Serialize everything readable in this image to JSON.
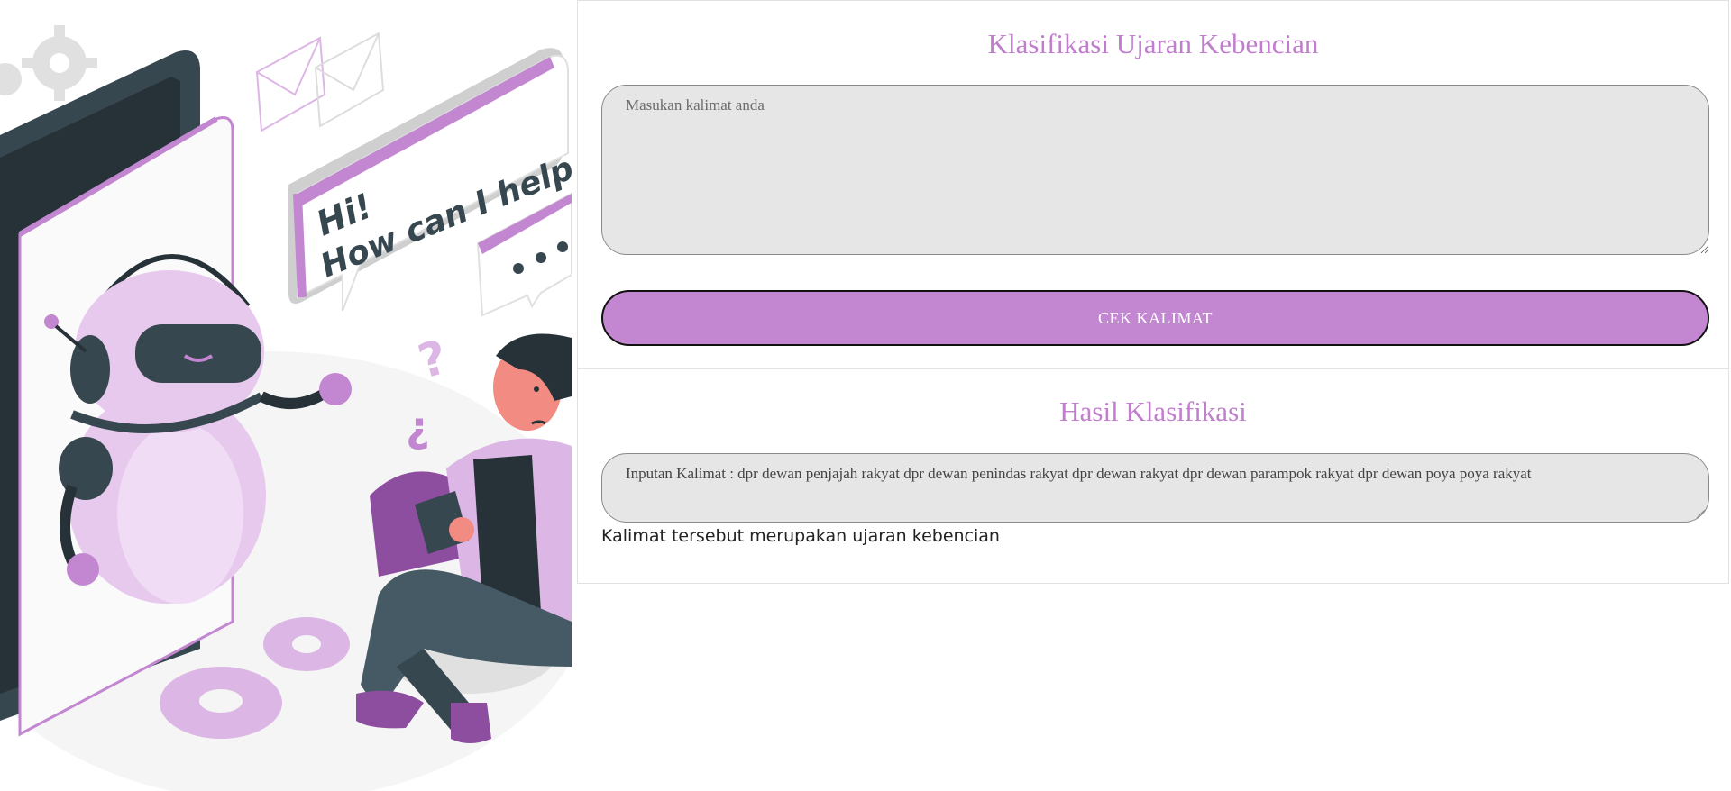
{
  "illustration": {
    "speech_line1": "Hi!",
    "speech_line2": "How can I help you?",
    "colors": {
      "accent": "#c386d1",
      "accent_light": "#e7c9ee",
      "dark": "#37474f"
    }
  },
  "form": {
    "title": "Klasifikasi Ujaran Kebencian",
    "input_placeholder": "Masukan kalimat anda",
    "input_value": "",
    "submit_label": "CEK KALIMAT"
  },
  "result": {
    "title": "Hasil Klasifikasi",
    "input_text": "Inputan Kalimat : dpr dewan penjajah rakyat dpr dewan penindas rakyat dpr dewan rakyat dpr dewan parampok rakyat dpr dewan poya poya rakyat",
    "classification_text": "Kalimat tersebut merupakan ujaran kebencian"
  }
}
